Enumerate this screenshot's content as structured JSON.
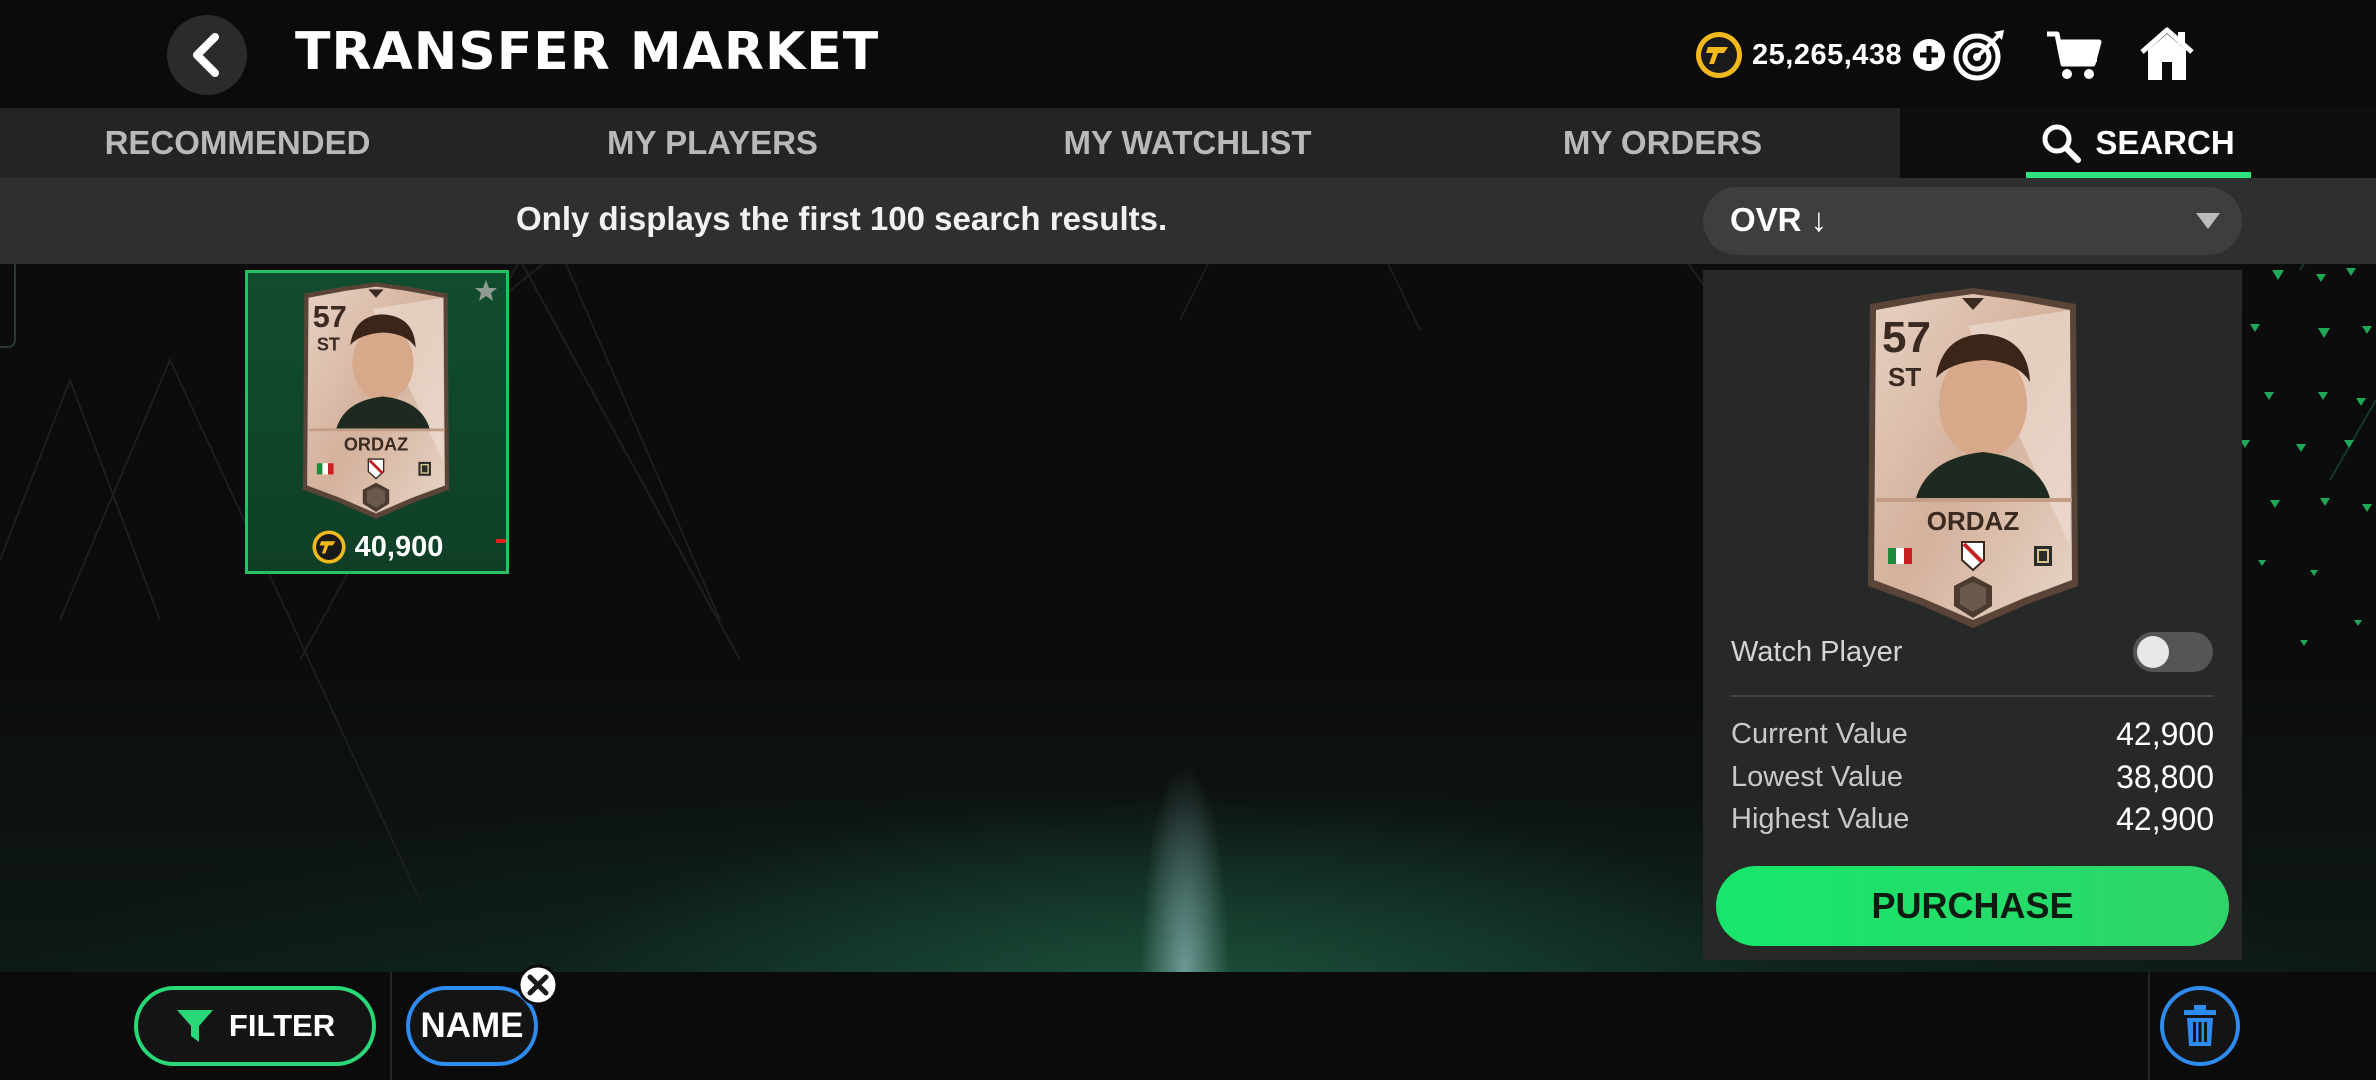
{
  "header": {
    "title": "TRANSFER MARKET",
    "coins": "25,265,438"
  },
  "tabs": [
    {
      "label": "RECOMMENDED",
      "active": false
    },
    {
      "label": "MY PLAYERS",
      "active": false
    },
    {
      "label": "MY WATCHLIST",
      "active": false
    },
    {
      "label": "MY ORDERS",
      "active": false
    },
    {
      "label": "SEARCH",
      "active": true
    }
  ],
  "infobar": {
    "message": "Only displays the first 100 search results.",
    "sort_value": "OVR ↓"
  },
  "result": {
    "rating": "57",
    "position": "ST",
    "name": "ORDAZ",
    "price": "40,900"
  },
  "detail": {
    "rating": "57",
    "position": "ST",
    "name": "ORDAZ",
    "watch_label": "Watch Player",
    "watch_on": false,
    "current_label": "Current Value",
    "current_value": "42,900",
    "lowest_label": "Lowest Value",
    "lowest_value": "38,800",
    "highest_label": "Highest Value",
    "highest_value": "42,900",
    "purchase_label": "PURCHASE"
  },
  "bottombar": {
    "filter_label": "FILTER",
    "name_chip": "NAME"
  },
  "colors": {
    "accent_green": "#2ee27e",
    "accent_blue": "#2e8bf0",
    "coin_gold": "#f2b81c"
  },
  "icons": [
    "back-chevron-icon",
    "coin-icon",
    "plus-icon",
    "target-icon",
    "cart-icon",
    "home-icon",
    "search-icon",
    "caret-down-icon",
    "star-icon",
    "filter-funnel-icon",
    "close-icon",
    "trash-icon"
  ]
}
